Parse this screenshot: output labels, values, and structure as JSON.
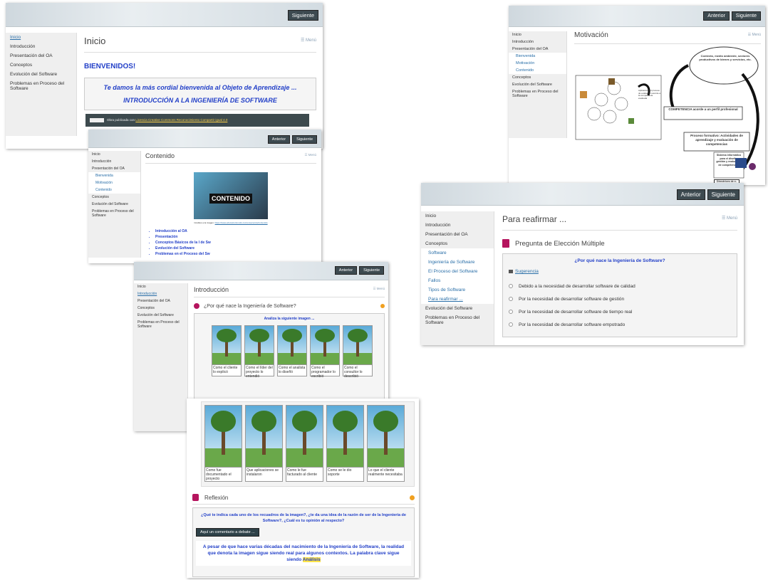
{
  "colors": {
    "accent": "#2a6fa8",
    "button": "#3d4a50",
    "heading": "#2340c8",
    "badge": "#b5145e"
  },
  "shot1": {
    "buttons": [
      "Siguiente"
    ],
    "sidebar": [
      "Inicio",
      "Introducción",
      "Presentación del OA",
      "Conceptos",
      "Evolución del Software",
      "Problemas en Proceso del Software"
    ],
    "title": "Inicio",
    "menu": "☰ Menú",
    "welcome": "BIENVENIDOS!",
    "greeting": "Te damos la más cordial bienvenida al Objeto de Aprendizaje ...",
    "course": "INTRODUCCIÓN A LA INGENIERÍA DE SOFTWARE",
    "license_prefix": "Obra publicada con ",
    "license_link": "Licencia Creative Commons Reconocimiento Compartir igual 4.0"
  },
  "shot2": {
    "buttons": [
      "Anterior",
      "Siguiente"
    ],
    "sidebar": [
      {
        "t": "Inicio",
        "k": ""
      },
      {
        "t": "Introducción",
        "k": ""
      },
      {
        "t": "Presentación del OA",
        "k": ""
      },
      {
        "t": "Bienvenida",
        "k": "sub"
      },
      {
        "t": "Motivación",
        "k": "sub"
      },
      {
        "t": "Contenido",
        "k": "sub"
      },
      {
        "t": "Conceptos",
        "k": ""
      },
      {
        "t": "Evolución del Software",
        "k": ""
      },
      {
        "t": "Problemas en Proceso del Software",
        "k": ""
      }
    ],
    "title": "Contenido",
    "menu": "☰ Menú",
    "image_word": "CONTENIDO",
    "source": "Créditos a la imagen: ",
    "source_link": "https://www.educaciontrends.com/ensenanza/contenido",
    "links": [
      "Introducción al OA",
      "Presentación",
      "Conceptos Básicos de la I de Sw",
      "Evolución del Software",
      "Problemas en el Proceso del Sw"
    ]
  },
  "shot3": {
    "buttons": [
      "Anterior",
      "Siguiente"
    ],
    "sidebar": [
      {
        "t": "Inicio",
        "k": ""
      },
      {
        "t": "Introducción",
        "k": "act"
      },
      {
        "t": "Presentación del OA",
        "k": ""
      },
      {
        "t": "Conceptos",
        "k": ""
      },
      {
        "t": "Evolución del Software",
        "k": ""
      },
      {
        "t": "Problemas en Proceso del Software",
        "k": ""
      }
    ],
    "title": "Introducción",
    "menu": "☰ Menú",
    "question": "¿Por qué nace la Ingeniería de Software?",
    "instruction": "Analiza la siguiente imagen ...",
    "captions": [
      "Como el cliente lo explicó",
      "Como el líder del proyecto lo entendió",
      "Como el analista lo diseñó",
      "Como el programador lo escribió",
      "Como el consultor lo describió"
    ]
  },
  "shot4": {
    "captions": [
      "Como fue documentado el proyecto",
      "Que aplicaciones se instalaron",
      "Como le fue facturado al cliente",
      "Como se le dio soporte",
      "Lo que el cliente realmente necesitaba"
    ],
    "section": "Reflexión",
    "question": "¿Qué te indica cada uno de los recuadros de la imagen?, ¿te da una idea de la razón de ser de la Ingeniería de Software?, ¿Cuál es tu opinión al respecto?",
    "debate_btn": "Aquí un comentario a debate ...",
    "answer": "A pesar de que hace varias décadas del nacimiento de la Ingeniería de Software, la realidad que denota la imagen sigue siendo real para algunos contextos.  La palabra clave sigue siendo ",
    "keyword": "Análisis"
  },
  "shot5": {
    "buttons": [
      "Anterior",
      "Siguiente"
    ],
    "sidebar": [
      {
        "t": "Inicio",
        "k": ""
      },
      {
        "t": "Introducción",
        "k": ""
      },
      {
        "t": "Presentación del OA",
        "k": ""
      },
      {
        "t": "Bienvenida",
        "k": "sub"
      },
      {
        "t": "Motivación",
        "k": "sub"
      },
      {
        "t": "Contenido",
        "k": "sub"
      },
      {
        "t": "Conceptos",
        "k": ""
      },
      {
        "t": "Evolución del Software",
        "k": ""
      },
      {
        "t": "Problemas en Proceso del Software",
        "k": ""
      }
    ],
    "title": "Motivación",
    "menu": "☰ Menú",
    "cloud": "Contexto, medio ambiente, sectores productivos de bienes y servicios, etc.",
    "competencia": "COMPETENCIA acorde a un perfil profesional",
    "proceso": "Proceso formativo: Actividades de aprendizaje y evaluación de competencias",
    "sistema": "Sistema informático para el diseño, gestión y evaluación de competencias",
    "directrices": "Directrices de e-evaluación",
    "sider": "Aplicación del proceso de evaluación acorde a la competencia evaluada"
  },
  "shot6": {
    "buttons": [
      "Anterior",
      "Siguiente"
    ],
    "sidebar": [
      {
        "t": "Inicio",
        "k": ""
      },
      {
        "t": "Introducción",
        "k": ""
      },
      {
        "t": "Presentación del OA",
        "k": ""
      },
      {
        "t": "Conceptos",
        "k": ""
      },
      {
        "t": "Software",
        "k": "sub"
      },
      {
        "t": "Ingeniería de Software",
        "k": "sub"
      },
      {
        "t": "El Proceso del Software",
        "k": "sub"
      },
      {
        "t": "Fallos",
        "k": "sub"
      },
      {
        "t": "Tipos de Software",
        "k": "sub"
      },
      {
        "t": "Para reafirmar ...",
        "k": "sub act"
      },
      {
        "t": "Evolución del Software",
        "k": ""
      },
      {
        "t": "Problemas en Proceso del Software",
        "k": ""
      }
    ],
    "title": "Para reafirmar ...",
    "menu": "☰ Menú",
    "section": "Pregunta de Elección Múltiple",
    "question": "¿Por qué nace la Ingeniería de Software?",
    "hint": "Sugerencia",
    "options": [
      "Debido a la necesidad de desarrollar software de calidad",
      "Por la necesidad de desarrollar software de gestión",
      "Por la necesidad de desarrollar software de tiempo real",
      "Por la necesidad de desarrollar software empotrado"
    ]
  }
}
